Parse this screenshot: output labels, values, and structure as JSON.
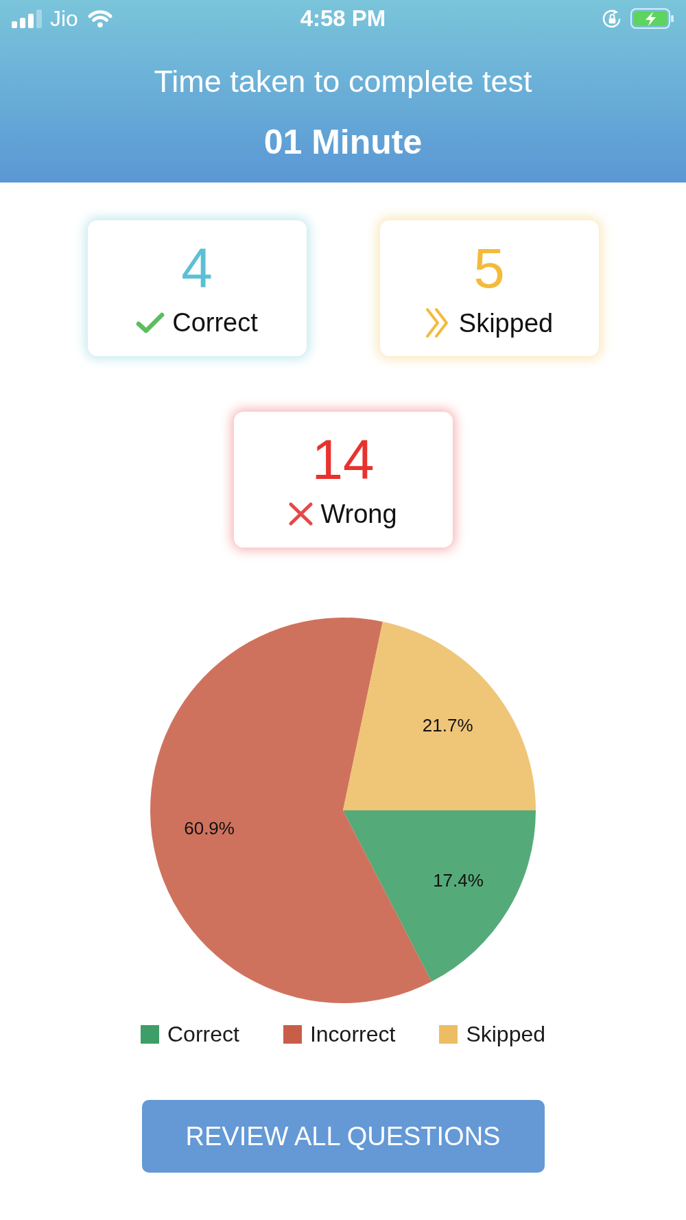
{
  "status_bar": {
    "carrier": "Jio",
    "time": "4:58 PM"
  },
  "header": {
    "title": "Time taken to complete test",
    "duration": "01 Minute"
  },
  "stats": [
    {
      "kind": "correct",
      "count": "4",
      "label": "Correct",
      "color": "#5bc0d4"
    },
    {
      "kind": "skipped",
      "count": "5",
      "label": "Skipped",
      "color": "#f3bb3b"
    },
    {
      "kind": "wrong",
      "count": "14",
      "label": "Wrong",
      "color": "#e8322e"
    }
  ],
  "results_chart": {
    "chart_data": {
      "type": "pie",
      "categories": [
        "Correct",
        "Incorrect",
        "Skipped"
      ],
      "values": [
        17.4,
        60.9,
        21.7
      ],
      "colors": [
        "#3e9e67",
        "#c85e47",
        "#edbd64"
      ],
      "value_labels": [
        "17.4%",
        "60.9%",
        "21.7%"
      ],
      "legend": "bottom"
    }
  },
  "review_button": {
    "label": "REVIEW ALL QUESTIONS"
  }
}
